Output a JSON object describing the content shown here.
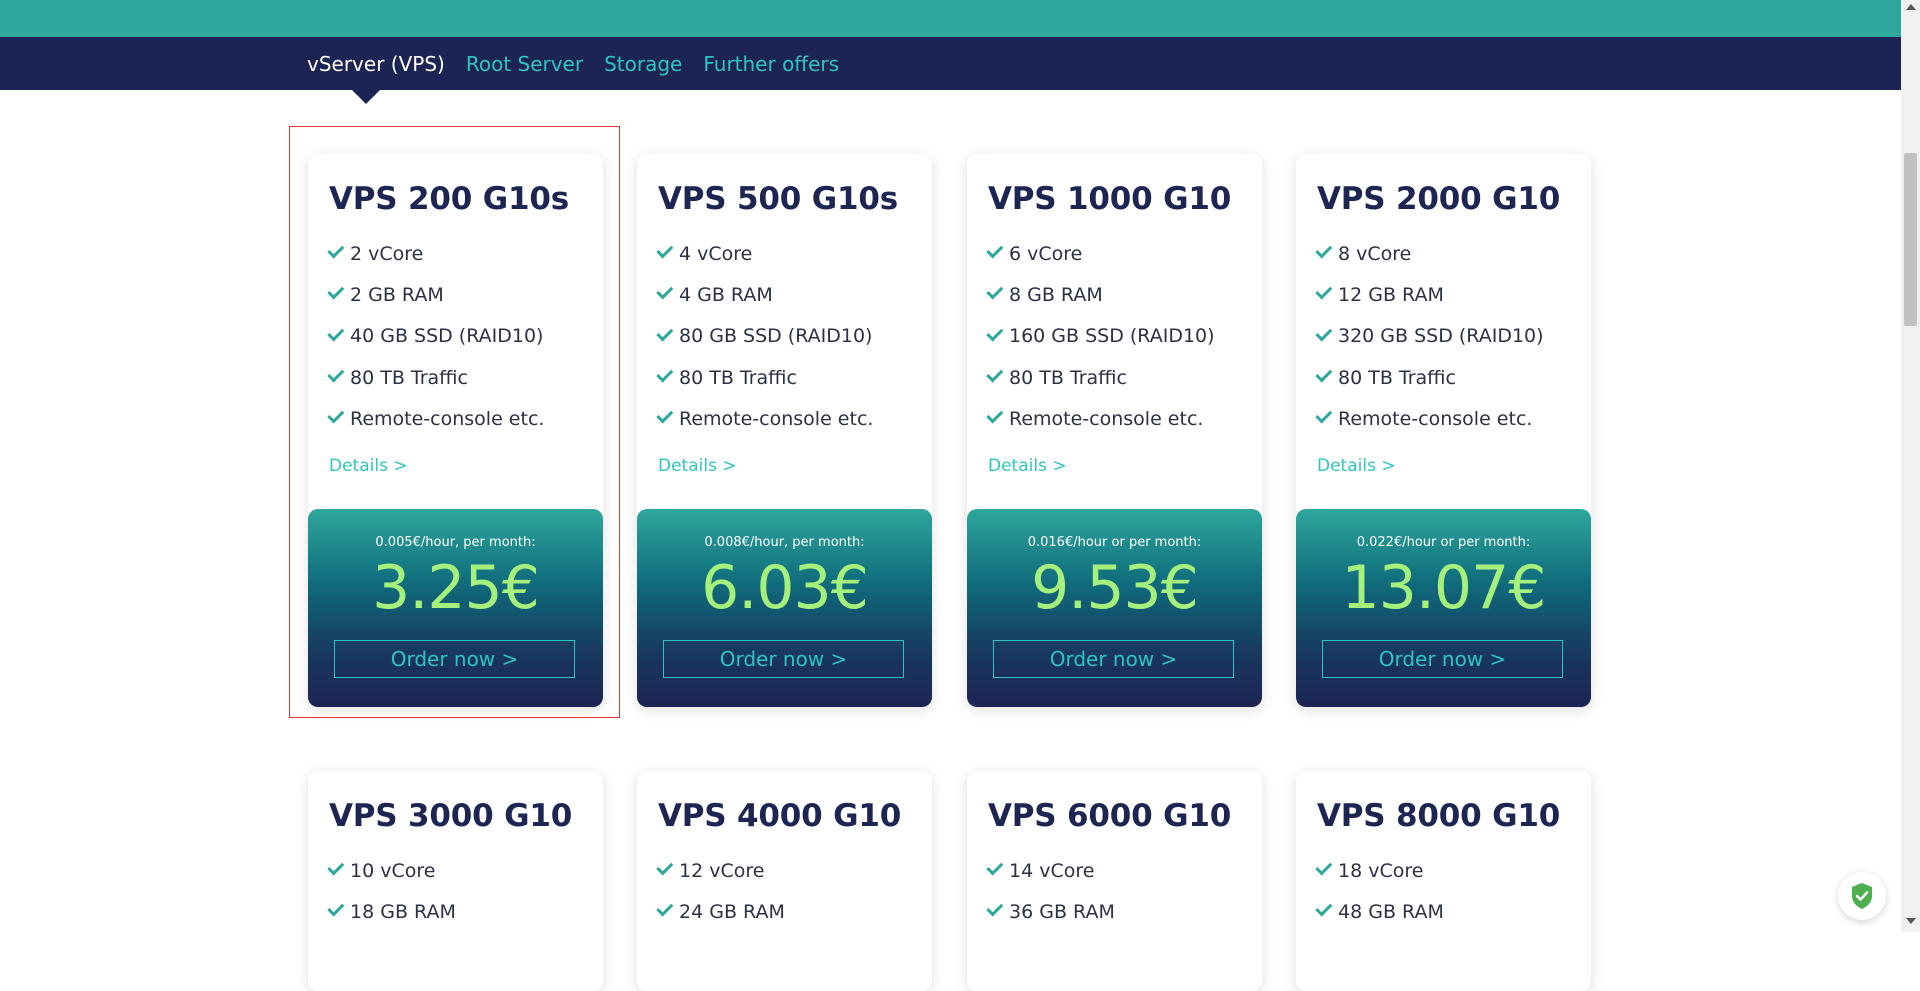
{
  "nav": {
    "tabs": [
      {
        "label": "vServer (VPS)",
        "active": true
      },
      {
        "label": "Root Server"
      },
      {
        "label": "Storage"
      },
      {
        "label": "Further offers"
      }
    ]
  },
  "colors": {
    "teal": "#2ea79d",
    "navy": "#1c2454",
    "accent": "#2ec5c0",
    "price": "#a6f07c"
  },
  "plans": [
    {
      "name": "VPS 200 G10s",
      "features": [
        "2 vCore",
        "2 GB RAM",
        "40 GB SSD (RAID10)",
        "80 TB Traffic",
        "Remote-console etc."
      ],
      "details": "Details >",
      "note": "0.005€/hour, per month:",
      "price": "3.25€",
      "order": "Order now >"
    },
    {
      "name": "VPS 500 G10s",
      "features": [
        "4 vCore",
        "4 GB RAM",
        "80 GB SSD (RAID10)",
        "80 TB Traffic",
        "Remote-console etc."
      ],
      "details": "Details >",
      "note": "0.008€/hour, per month:",
      "price": "6.03€",
      "order": "Order now >"
    },
    {
      "name": "VPS 1000 G10",
      "features": [
        "6 vCore",
        "8 GB RAM",
        "160 GB SSD (RAID10)",
        "80 TB Traffic",
        "Remote-console etc."
      ],
      "details": "Details >",
      "note": "0.016€/hour or per month:",
      "price": "9.53€",
      "order": "Order now >"
    },
    {
      "name": "VPS 2000 G10",
      "features": [
        "8 vCore",
        "12 GB RAM",
        "320 GB SSD (RAID10)",
        "80 TB Traffic",
        "Remote-console etc."
      ],
      "details": "Details >",
      "note": "0.022€/hour or per month:",
      "price": "13.07€",
      "order": "Order now >"
    },
    {
      "name": "VPS 3000 G10",
      "features": [
        "10 vCore",
        "18 GB RAM"
      ]
    },
    {
      "name": "VPS 4000 G10",
      "features": [
        "12 vCore",
        "24 GB RAM"
      ]
    },
    {
      "name": "VPS 6000 G10",
      "features": [
        "14 vCore",
        "36 GB RAM"
      ]
    },
    {
      "name": "VPS 8000 G10",
      "features": [
        "18 vCore",
        "48 GB RAM"
      ]
    }
  ]
}
